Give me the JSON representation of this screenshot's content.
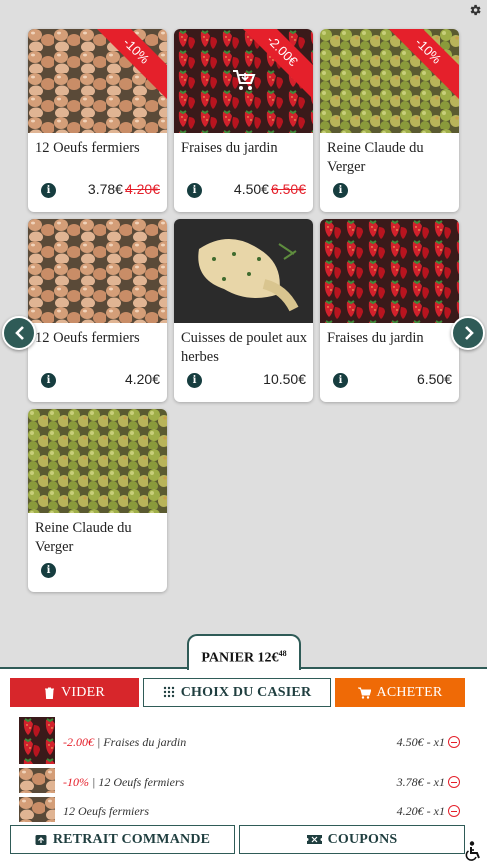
{
  "products": [
    {
      "name": "12 Oeufs fermiers",
      "price": "3.78€",
      "old_price": "4.20€",
      "badge": "-10%",
      "image": "eggs"
    },
    {
      "name": "Fraises du jardin",
      "price": "4.50€",
      "old_price": "6.50€",
      "badge": "-2.00€",
      "image": "strawberries",
      "in_cart": true
    },
    {
      "name": "Reine Claude du Verger",
      "price": "",
      "old_price": "",
      "badge": "-10%",
      "image": "plums"
    },
    {
      "name": "12 Oeufs fermiers",
      "price": "4.20€",
      "old_price": "",
      "badge": "",
      "image": "eggs"
    },
    {
      "name": "Cuisses de poulet aux herbes",
      "price": "10.50€",
      "old_price": "",
      "badge": "",
      "image": "chicken"
    },
    {
      "name": "Fraises du jardin",
      "price": "6.50€",
      "old_price": "",
      "badge": "",
      "image": "strawberries"
    },
    {
      "name": "Reine Claude du Verger",
      "price": "",
      "old_price": "",
      "badge": "",
      "image": "plums"
    }
  ],
  "cart": {
    "tab_label": "PANIER 12€",
    "tab_cents": "48",
    "buttons": {
      "clear": "VIDER",
      "locker": "CHOIX DU CASIER",
      "buy": "ACHETER",
      "pickup": "RETRAIT COMMANDE",
      "coupons": "COUPONS"
    },
    "items": [
      {
        "discount": "-2.00€",
        "sep": " | ",
        "name": "Fraises du jardin",
        "price": "4.50€ - x1",
        "image": "strawberries"
      },
      {
        "discount": "-10%",
        "sep": " | ",
        "name": "12 Oeufs fermiers",
        "price": "3.78€ - x1",
        "image": "eggs"
      },
      {
        "discount": "",
        "sep": "",
        "name": "12 Oeufs fermiers",
        "price": "4.20€ - x1",
        "image": "eggs"
      }
    ]
  },
  "colors": {
    "teal": "#2f5b57",
    "red": "#d7262b",
    "orange": "#ef6a06",
    "discount": "#e5202b"
  },
  "icons": {
    "settings": "gear-icon",
    "prev": "chevron-left-icon",
    "next": "chevron-right-icon",
    "info": "info-icon",
    "trash": "trash-icon",
    "grid": "grid-dots-icon",
    "cart": "cart-icon",
    "minus": "minus-circle-icon",
    "box": "box-icon",
    "ticket": "ticket-icon",
    "accessibility": "accessibility-icon"
  }
}
